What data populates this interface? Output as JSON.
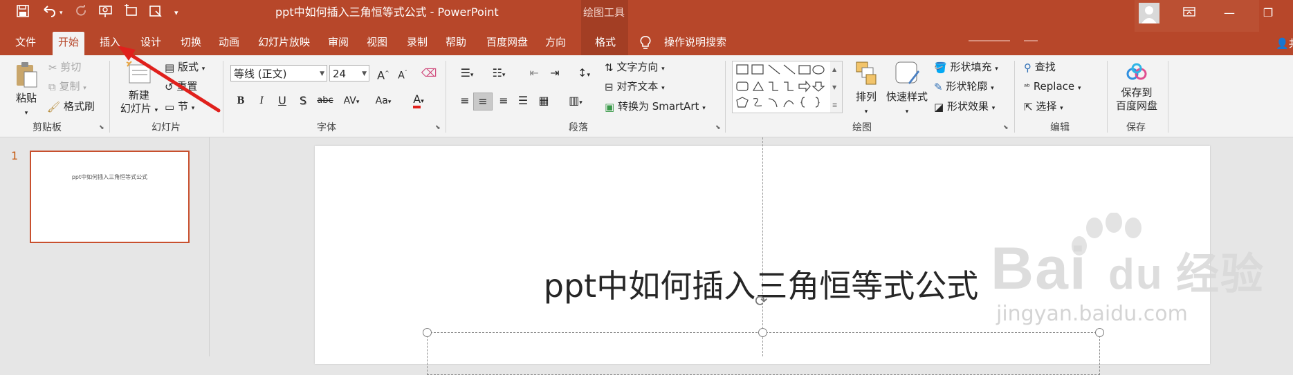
{
  "app": {
    "window_title": "ppt中如何插入三角恒等式公式  -  PowerPoint",
    "context_group": "绘图工具",
    "tell_me": "操作说明搜索",
    "share_label": "共"
  },
  "quick_access": {
    "icons": [
      "save-icon",
      "undo-icon",
      "redo-icon",
      "start-from-beginning-icon",
      "new-slide-icon",
      "from-file-icon",
      "customize-icon"
    ]
  },
  "tabs": [
    {
      "label": "文件",
      "active": false
    },
    {
      "label": "开始",
      "active": true
    },
    {
      "label": "插入",
      "active": false
    },
    {
      "label": "设计",
      "active": false
    },
    {
      "label": "切换",
      "active": false
    },
    {
      "label": "动画",
      "active": false
    },
    {
      "label": "幻灯片放映",
      "active": false
    },
    {
      "label": "审阅",
      "active": false
    },
    {
      "label": "视图",
      "active": false
    },
    {
      "label": "录制",
      "active": false
    },
    {
      "label": "帮助",
      "active": false
    },
    {
      "label": "百度网盘",
      "active": false
    },
    {
      "label": "方向",
      "active": false
    },
    {
      "label": "格式",
      "active": false
    }
  ],
  "ribbon": {
    "clipboard": {
      "label": "剪贴板",
      "paste": "粘贴",
      "cut": "剪切",
      "copy": "复制",
      "format_painter": "格式刷"
    },
    "slides": {
      "label": "幻灯片",
      "new_slide_line1": "新建",
      "new_slide_line2": "幻灯片",
      "layout": "版式",
      "reset": "重置",
      "section": "节"
    },
    "font": {
      "label": "字体",
      "font_name": "等线 (正文)",
      "font_size": "24",
      "bold": "B",
      "italic": "I",
      "underline": "U",
      "shadow": "S",
      "strike": "abc",
      "spacing": "AV",
      "case": "Aa",
      "color": "A"
    },
    "paragraph": {
      "label": "段落",
      "text_direction": "文字方向",
      "align_text": "对齐文本",
      "convert_smartart": "转换为 SmartArt"
    },
    "drawing": {
      "label": "绘图",
      "arrange": "排列",
      "quick_styles": "快速样式",
      "shape_fill": "形状填充",
      "shape_outline": "形状轮廓",
      "shape_effects": "形状效果"
    },
    "editing": {
      "label": "编辑",
      "find": "查找",
      "replace": "Replace",
      "select": "选择"
    },
    "save": {
      "label": "保存",
      "save_line1": "保存到",
      "save_line2": "百度网盘"
    }
  },
  "thumbnails": [
    {
      "number": "1",
      "title": "ppt中如何插入三角恒等式公式"
    }
  ],
  "slide": {
    "title": "ppt中如何插入三角恒等式公式"
  },
  "watermark": {
    "brand": "Bai du 经验",
    "url": "jingyan.baidu.com"
  },
  "colors": {
    "brand": "#b7472a",
    "ribbon": "#f3f3f3",
    "canvas": "#e6e6e6",
    "annotation": "#e0201c"
  }
}
